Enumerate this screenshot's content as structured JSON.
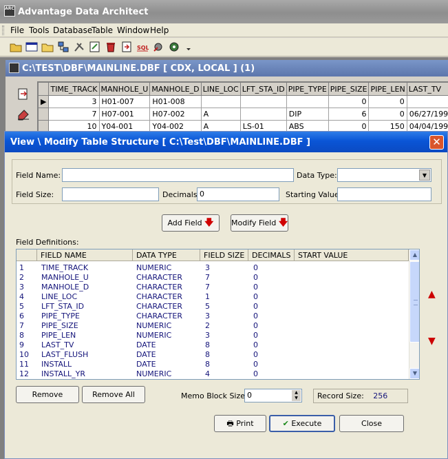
{
  "app": {
    "title": "Advantage Data Architect",
    "icon_text": "ARC"
  },
  "menu": {
    "file": "File",
    "tools": "Tools",
    "database": "Database",
    "table": "Table",
    "window": "Window",
    "help": "Help"
  },
  "child": {
    "title": "C:\\TEST\\DBF\\MAINLINE.DBF [ CDX, LOCAL ] (1)"
  },
  "grid": {
    "columns": [
      "TIME_TRACK",
      "MANHOLE_U",
      "MANHOLE_D",
      "LINE_LOC",
      "LFT_STA_ID",
      "PIPE_TYPE",
      "PIPE_SIZE",
      "PIPE_LEN",
      "LAST_TV"
    ],
    "rows": [
      [
        "3",
        "H01-007",
        "H01-008",
        "",
        "",
        "",
        "0",
        "0",
        ""
      ],
      [
        "7",
        "H07-001",
        "H07-002",
        "A",
        "",
        "DIP",
        "6",
        "0",
        "06/27/199"
      ],
      [
        "10",
        "Y04-001",
        "Y04-002",
        "A",
        "LS-01",
        "ABS",
        "0",
        "150",
        "04/04/199"
      ]
    ]
  },
  "dialog": {
    "title": "View \\ Modify Table Structure  [ C:\\Test\\DBF\\MAINLINE.DBF ]",
    "close_symbol": "✕",
    "field_name_label": "Field Name:",
    "field_name_value": "",
    "data_type_label": "Data Type:",
    "data_type_value": "",
    "field_size_label": "Field Size:",
    "field_size_value": "",
    "decimals_label": "Decimals:",
    "decimals_value": "0",
    "starting_value_label": "Starting Value:",
    "starting_value_value": "",
    "add_field_label": "Add Field",
    "modify_field_label": "Modify Field",
    "field_definitions_label": "Field Definitions:",
    "list_headers": [
      "FIELD NAME",
      "DATA TYPE",
      "FIELD SIZE",
      "DECIMALS",
      "START VALUE"
    ],
    "fields": [
      {
        "no": "1",
        "name": "TIME_TRACK",
        "type": "NUMERIC",
        "size": "3",
        "decimals": "0"
      },
      {
        "no": "2",
        "name": "MANHOLE_U",
        "type": "CHARACTER",
        "size": "7",
        "decimals": "0"
      },
      {
        "no": "3",
        "name": "MANHOLE_D",
        "type": "CHARACTER",
        "size": "7",
        "decimals": "0"
      },
      {
        "no": "4",
        "name": "LINE_LOC",
        "type": "CHARACTER",
        "size": "1",
        "decimals": "0"
      },
      {
        "no": "5",
        "name": "LFT_STA_ID",
        "type": "CHARACTER",
        "size": "5",
        "decimals": "0"
      },
      {
        "no": "6",
        "name": "PIPE_TYPE",
        "type": "CHARACTER",
        "size": "3",
        "decimals": "0"
      },
      {
        "no": "7",
        "name": "PIPE_SIZE",
        "type": "NUMERIC",
        "size": "2",
        "decimals": "0"
      },
      {
        "no": "8",
        "name": "PIPE_LEN",
        "type": "NUMERIC",
        "size": "3",
        "decimals": "0"
      },
      {
        "no": "9",
        "name": "LAST_TV",
        "type": "DATE",
        "size": "8",
        "decimals": "0"
      },
      {
        "no": "10",
        "name": "LAST_FLUSH",
        "type": "DATE",
        "size": "8",
        "decimals": "0"
      },
      {
        "no": "11",
        "name": "INSTALL",
        "type": "DATE",
        "size": "8",
        "decimals": "0"
      },
      {
        "no": "12",
        "name": "INSTALL_YR",
        "type": "NUMERIC",
        "size": "4",
        "decimals": "0"
      }
    ],
    "remove_label": "Remove",
    "remove_all_label": "Remove All",
    "memo_block_size_label": "Memo Block Size:",
    "memo_block_size_value": "0",
    "record_size_label": "Record Size:",
    "record_size_value": "256",
    "print_label": "Print",
    "execute_label": "Execute",
    "close_label": "Close"
  },
  "colors": {
    "dialog_title_bg": "#0a55d6",
    "list_text": "#14147a",
    "arrow_red": "#d00000"
  }
}
